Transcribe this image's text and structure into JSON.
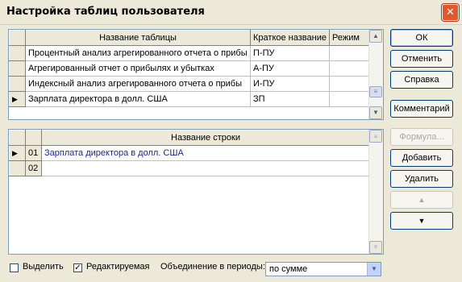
{
  "window": {
    "title": "Настройка таблиц пользователя",
    "close_glyph": "✕"
  },
  "tables_grid": {
    "columns": [
      "Название таблицы",
      "Краткое название",
      "Режим"
    ],
    "rows": [
      {
        "name": "Процентный анализ агрегированного отчета о прибы",
        "short": "П-ПУ",
        "mode": "",
        "current": false
      },
      {
        "name": "Агрегированный отчет о прибылях и убытках",
        "short": "А-ПУ",
        "mode": "",
        "current": false
      },
      {
        "name": "Индексный анализ агрегированного отчета о прибы",
        "short": "И-ПУ",
        "mode": "",
        "current": false
      },
      {
        "name": "Зарплата директора в долл. США",
        "short": "ЗП",
        "mode": "",
        "current": true
      }
    ]
  },
  "rows_grid": {
    "columns": [
      "Название строки"
    ],
    "rows": [
      {
        "num": "01",
        "name": "Зарплата директора в долл. США",
        "current": true
      },
      {
        "num": "02",
        "name": "",
        "current": false
      }
    ]
  },
  "buttons": {
    "ok": "ОК",
    "cancel": "Отменить",
    "help": "Справка",
    "comment": "Комментарий",
    "formula": "Формула...",
    "add": "Добавить",
    "delete": "Удалить"
  },
  "options": {
    "highlight_label": "Выделить",
    "highlight_checked": false,
    "editable_label": "Редактируемая",
    "editable_checked": true,
    "merge_label": "Объединение в периоды:",
    "merge_value": "по сумме"
  },
  "icons": {
    "row_pointer": "▶",
    "up": "▲",
    "down": "▼",
    "check": "✓"
  }
}
